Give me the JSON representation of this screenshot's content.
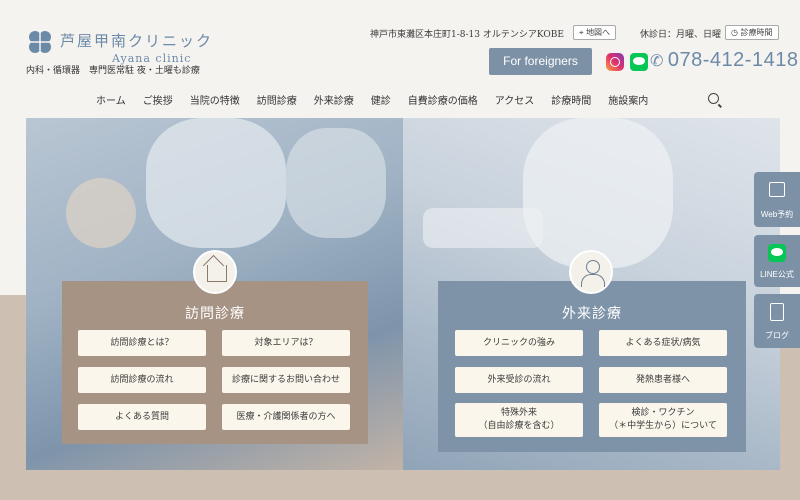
{
  "header": {
    "logo_jp": "芦屋甲南クリニック",
    "logo_en": "Ayana clinic",
    "tagline": "内科・循環器　専門医常駐 夜・土曜も診療",
    "address": "神戸市東灘区本庄町1-8-13 オルテンシアKOBE",
    "map_button": "地図へ",
    "holiday": "休診日：月曜、日曜",
    "hours_button": "診療時間",
    "foreigners_button": "For foreigners",
    "phone": "078-412-1418"
  },
  "nav": [
    "ホーム",
    "ご挨拶",
    "当院の特徴",
    "訪問診療",
    "外来診療",
    "健診",
    "自費診療の価格",
    "アクセス",
    "診療時間",
    "施設案内"
  ],
  "cards": {
    "left": {
      "title": "訪問診療",
      "buttons": [
        "訪問診療とは？",
        "対象エリアは？",
        "訪問診療の流れ",
        "診療に関するお問い合わせ",
        "よくある質問",
        "医療・介護関係者の方へ"
      ]
    },
    "right": {
      "title": "外来診療",
      "buttons": [
        "クリニックの強み",
        "よくある症状/病気",
        "外来受診の流れ",
        "発熱患者様へ"
      ],
      "special": {
        "line1": "特殊外来",
        "line2": "（自由診療を含む）"
      },
      "vaccine": {
        "line1": "検診・ワクチン",
        "line2": "（＊中学生から）について"
      }
    }
  },
  "side": {
    "web": "Web予約",
    "line": "LINE公式",
    "blog": "ブログ"
  },
  "colors": {
    "accent": "#7c91a6",
    "logo": "#6b8aa8",
    "card_left": "#a69384",
    "card_right": "#7f93a8",
    "button_bg": "#faf6ec"
  }
}
